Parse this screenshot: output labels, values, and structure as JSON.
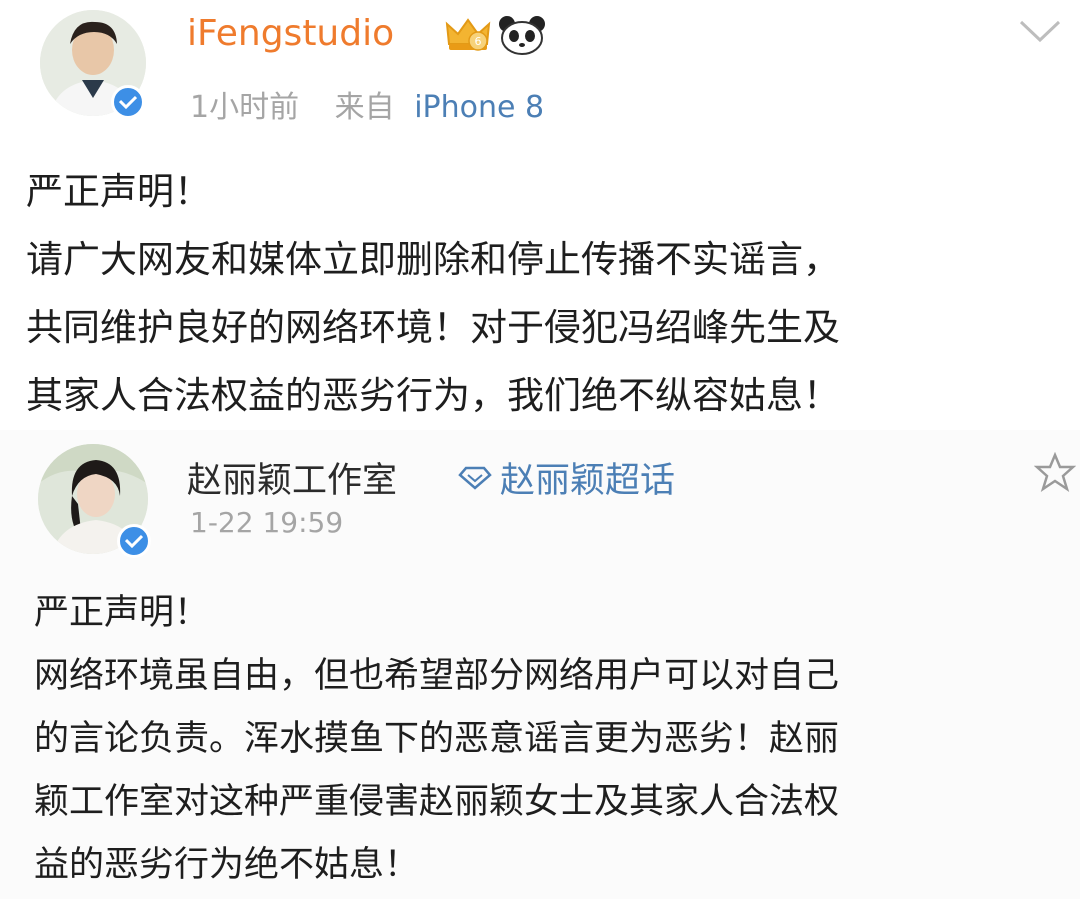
{
  "posts": [
    {
      "username": "iFengstudio",
      "time": "1小时前",
      "source_label": "来自",
      "source_device": "iPhone 8",
      "text": "严正声明！\n请广大网友和媒体立即删除和停止传播不实谣言，\n共同维护良好的网络环境！对于侵犯冯绍峰先生及\n其家人合法权益的恶劣行为，我们绝不纵容姑息！"
    },
    {
      "username": "赵丽颖工作室",
      "topic": "赵丽颖超话",
      "time": "1-22 19:59",
      "text": "严正声明！\n网络环境虽自由，但也希望部分网络用户可以对自己\n的言论负责。浑水摸鱼下的恶意谣言更为恶劣！赵丽\n颖工作室对这种严重侵害赵丽颖女士及其家人合法权\n益的恶劣行为绝不姑息！"
    }
  ],
  "colors": {
    "username_orange": "#ef7b2d",
    "link_blue": "#4c7fb5",
    "meta_gray": "#a5a5a5",
    "verified_blue": "#3d8fe6"
  },
  "icons": [
    "verified-icon",
    "crown-badge-icon",
    "panda-icon",
    "chevron-down-icon",
    "supertopic-icon",
    "star-icon"
  ]
}
